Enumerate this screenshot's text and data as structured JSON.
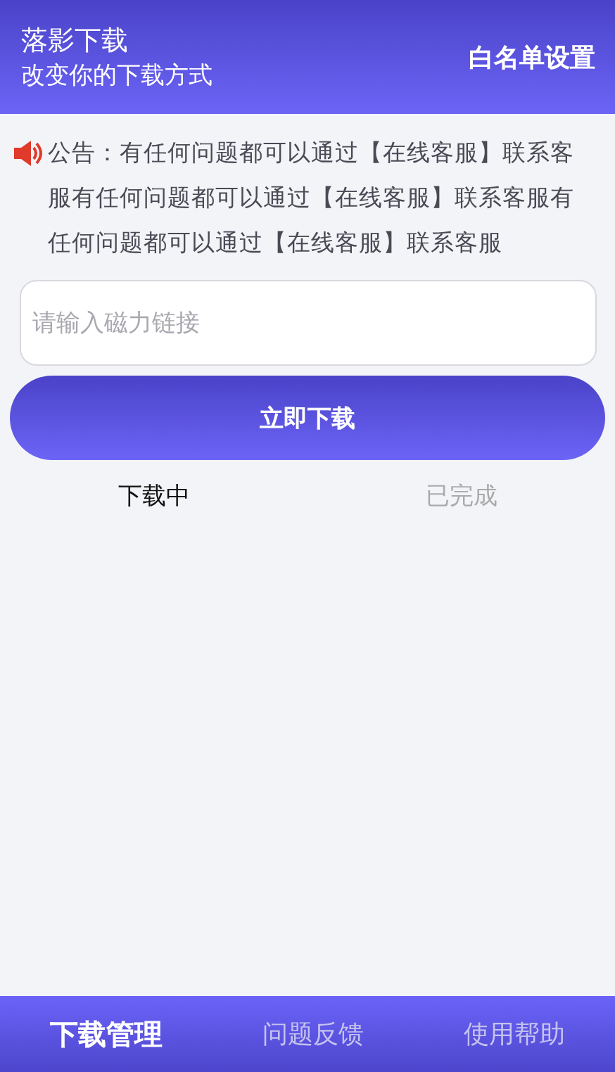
{
  "header": {
    "title": "落影下载",
    "subtitle": "改变你的下载方式",
    "action": "白名单设置"
  },
  "notice": {
    "text": "公告：有任何问题都可以通过【在线客服】联系客服有任何问题都可以通过【在线客服】联系客服有任何问题都可以通过【在线客服】联系客服"
  },
  "magnet_field": {
    "placeholder": "请输入磁力链接"
  },
  "download_button": "立即下载",
  "tabs": [
    {
      "label": "下载中",
      "selected": true
    },
    {
      "label": "已完成",
      "selected": false
    }
  ],
  "bottom_nav": [
    {
      "label": "下载管理",
      "selected": true
    },
    {
      "label": "问题反馈",
      "selected": false
    },
    {
      "label": "使用帮助",
      "selected": false
    }
  ]
}
